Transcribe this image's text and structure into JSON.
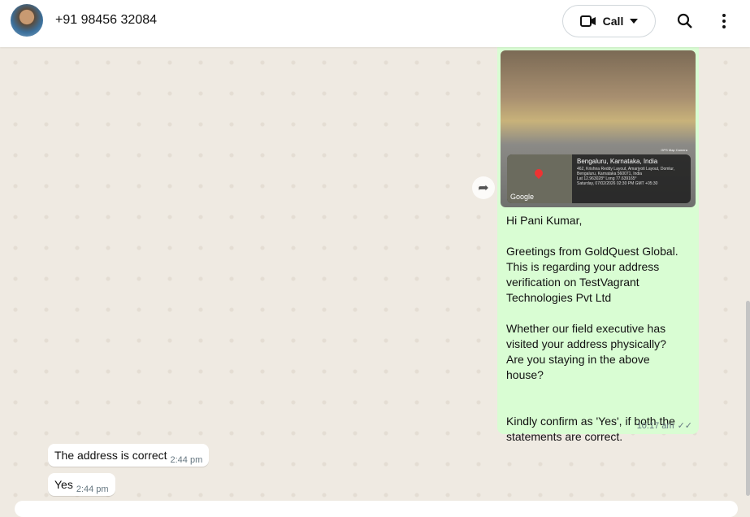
{
  "header": {
    "contact": "+91 98456 32084",
    "call_label": "Call"
  },
  "outgoing": {
    "location": {
      "city": "Bengaluru, Karnataka, India",
      "address": "462, Krishna Reddy Layout, Amarjyoti Layout, Domlur, Bengaluru, Karnataka 560071, India",
      "coords": "Lat 12.963028° Long 77.639165°",
      "datetime": "Saturday, 07/02/2026 02:30 PM GMT +05:30",
      "app": "GPS Map Camera",
      "map_brand": "Google"
    },
    "text": "Hi Pani Kumar,\n\nGreetings from GoldQuest Global.\nThis is regarding your address verification on TestVagrant Technologies Pvt Ltd\n\nWhether our field executive has visited your address physically?\nAre you staying in the above house?\n\n\nKindly confirm as 'Yes', if both the statements are correct.",
    "time": "10:17 am"
  },
  "incoming": [
    {
      "text": "The address is correct",
      "time": "2:44 pm"
    },
    {
      "text": "Yes",
      "time": "2:44 pm"
    }
  ]
}
